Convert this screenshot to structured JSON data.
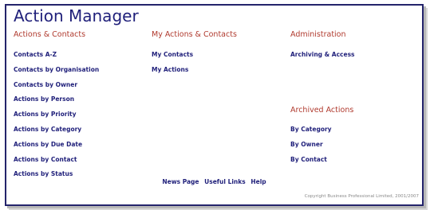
{
  "page": {
    "title": "Action Manager"
  },
  "columns": [
    {
      "heading": "Actions & Contacts",
      "links": [
        "Contacts A-Z",
        "Contacts by Organisation",
        "Contacts by Owner",
        "Actions by Person",
        "Actions by Priority",
        "Actions by Category",
        "Actions by Due Date",
        "Actions by Contact",
        "Actions by Status"
      ]
    },
    {
      "heading": "My Actions & Contacts",
      "links": [
        "My Contacts",
        "My Actions"
      ]
    },
    {
      "heading": "Administration",
      "links": [
        "Archiving & Access"
      ],
      "subsection": {
        "heading": "Archived Actions",
        "links": [
          "By Category",
          "By Owner",
          "By Contact"
        ]
      }
    }
  ],
  "footer": {
    "nav": [
      "News Page",
      "Useful Links",
      "Help"
    ],
    "copyright": "Copyright Business Professional Limited, 2001/2007"
  },
  "colors": {
    "title": "#1f1f7a",
    "heading": "#b03a2e",
    "link": "#1f1f7a",
    "border": "#24246b"
  }
}
